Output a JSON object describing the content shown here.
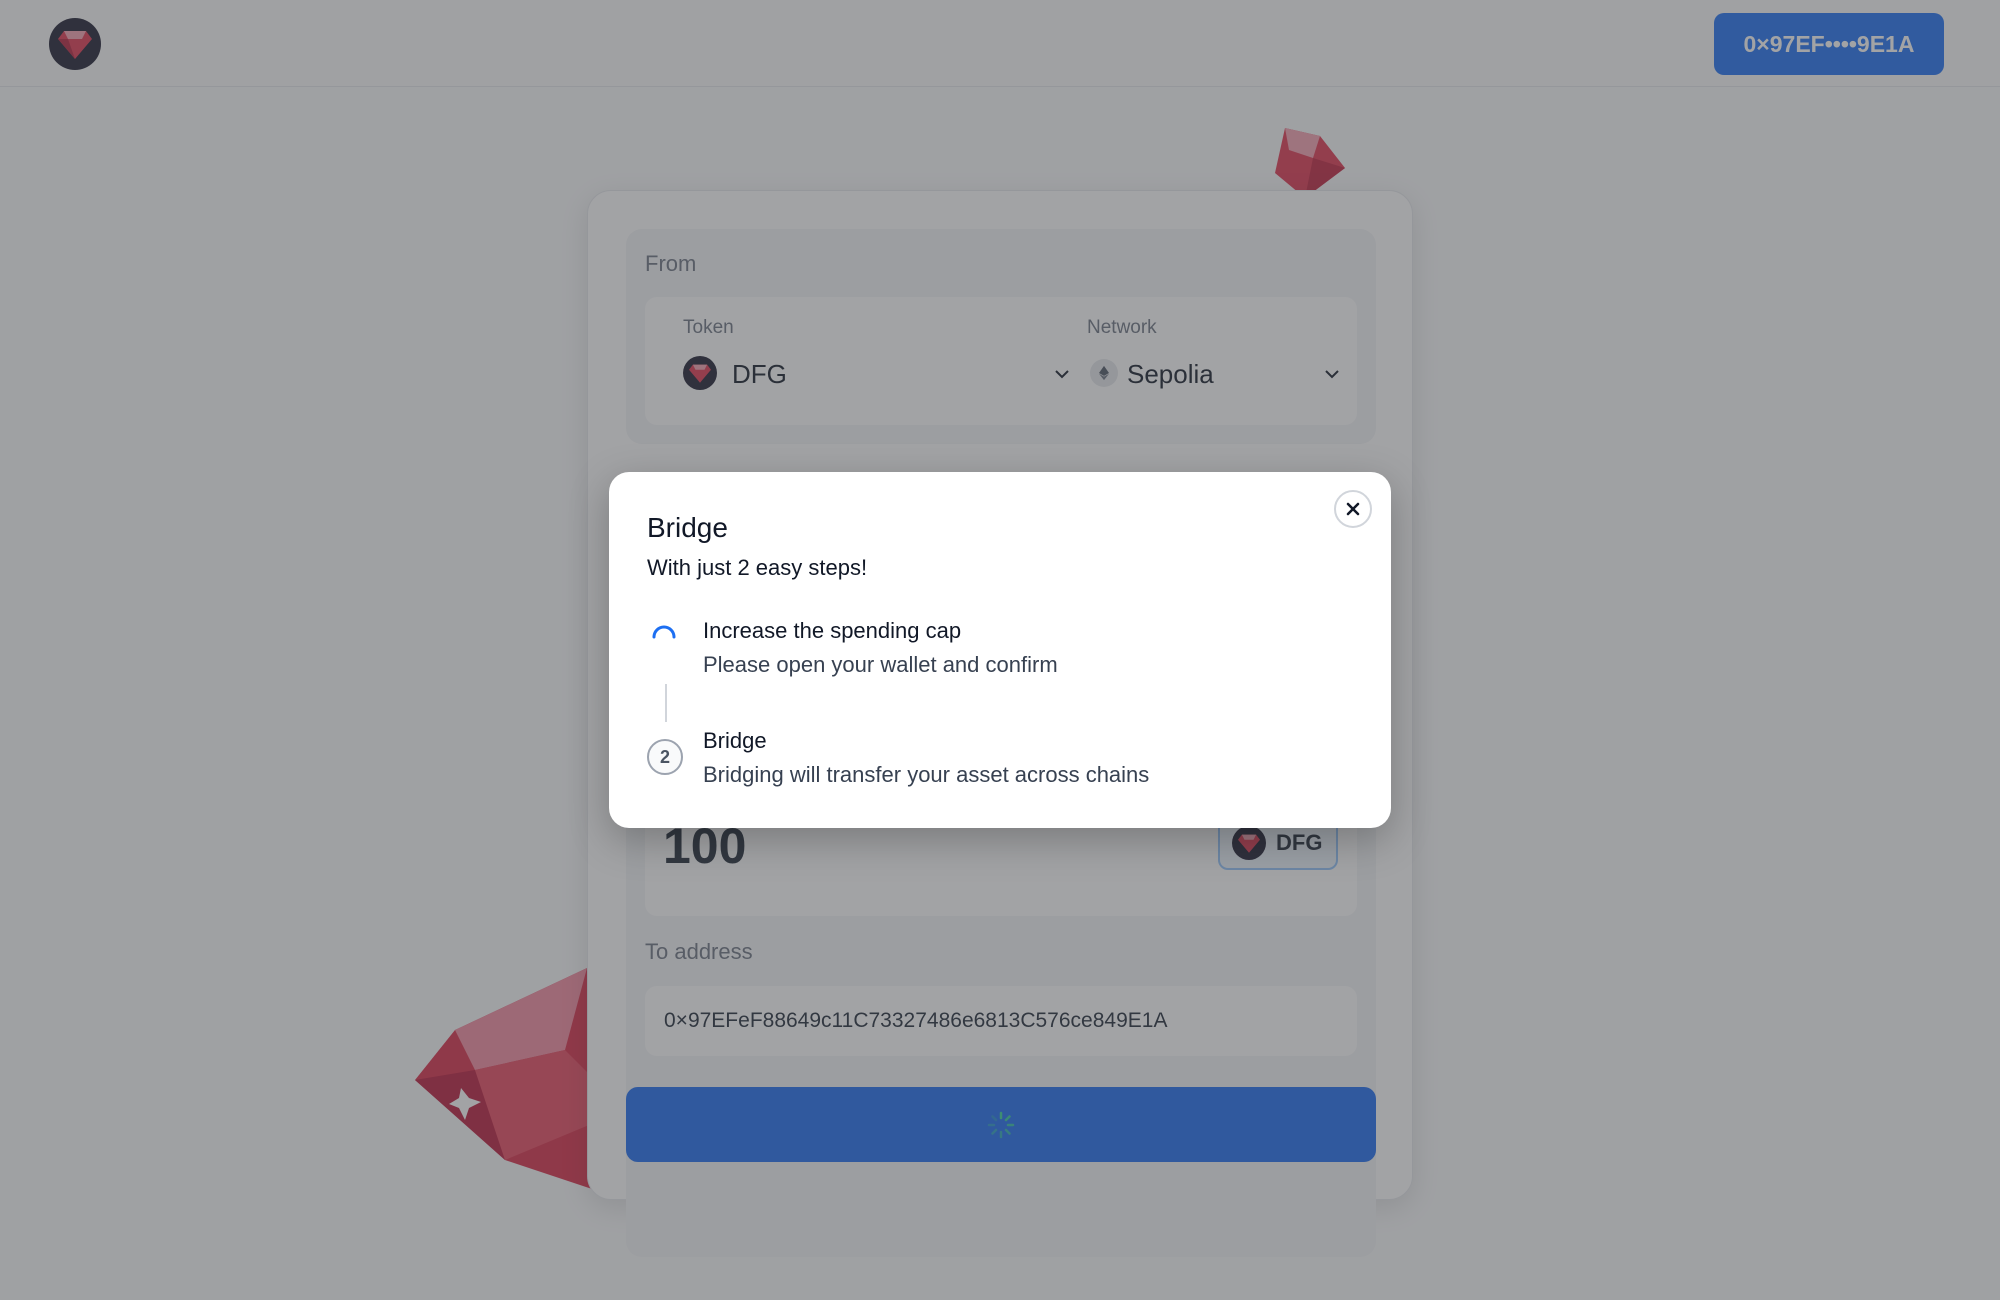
{
  "header": {
    "logo_icon": "ruby-gem-icon",
    "wallet_button_label": "0×97EF••••9E1A"
  },
  "from": {
    "section_label": "From",
    "token_label": "Token",
    "token_value": "DFG",
    "token_icon": "ruby-gem-icon",
    "network_label": "Network",
    "network_value": "Sepolia",
    "network_icon": "ethereum-icon"
  },
  "amount": {
    "value": "100",
    "token_chip_label": "DFG"
  },
  "to_address": {
    "label": "To address",
    "value": "0×97EFeF88649c11C73327486e6813C576ce849E1A"
  },
  "submit": {
    "state": "loading"
  },
  "modal": {
    "title": "Bridge",
    "subtitle": "With just 2 easy steps!",
    "steps": [
      {
        "indicator": "spinner",
        "title": "Increase the spending cap",
        "description": "Please open your wallet and confirm"
      },
      {
        "indicator": "2",
        "title": "Bridge",
        "description": "Bridging will transfer your asset across chains"
      }
    ],
    "close_icon": "close-icon"
  },
  "colors": {
    "accent": "#1d6ff2",
    "overlay": "#46484c",
    "gem": "#e0344f"
  }
}
